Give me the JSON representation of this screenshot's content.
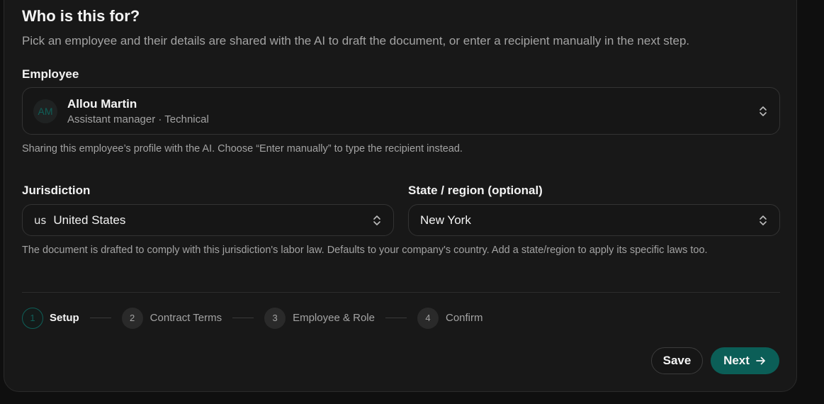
{
  "form": {
    "title": "Who is this for?",
    "subtitle": "Pick an employee and their details are shared with the AI to draft the document, or enter a recipient manually in the next step."
  },
  "employee": {
    "label": "Employee",
    "initials": "AM",
    "name": "Allou Martin",
    "details": "Assistant manager · Technical",
    "help": "Sharing this employee’s profile with the AI. Choose “Enter manually” to type the recipient instead."
  },
  "jurisdiction": {
    "label": "Jurisdiction",
    "flag": "us",
    "value": "United States"
  },
  "region": {
    "label": "State / region (optional)",
    "value": "New York"
  },
  "jurisdiction_help": "The document is drafted to comply with this jurisdiction's labor law. Defaults to your company's country. Add a state/region to apply its specific laws too.",
  "steps": [
    {
      "number": "1",
      "label": "Setup"
    },
    {
      "number": "2",
      "label": "Contract Terms"
    },
    {
      "number": "3",
      "label": "Employee & Role"
    },
    {
      "number": "4",
      "label": "Confirm"
    }
  ],
  "actions": {
    "save_label": "Save",
    "next_label": "Next"
  },
  "colors": {
    "accent": "#0b5e57",
    "background": "#181818"
  }
}
